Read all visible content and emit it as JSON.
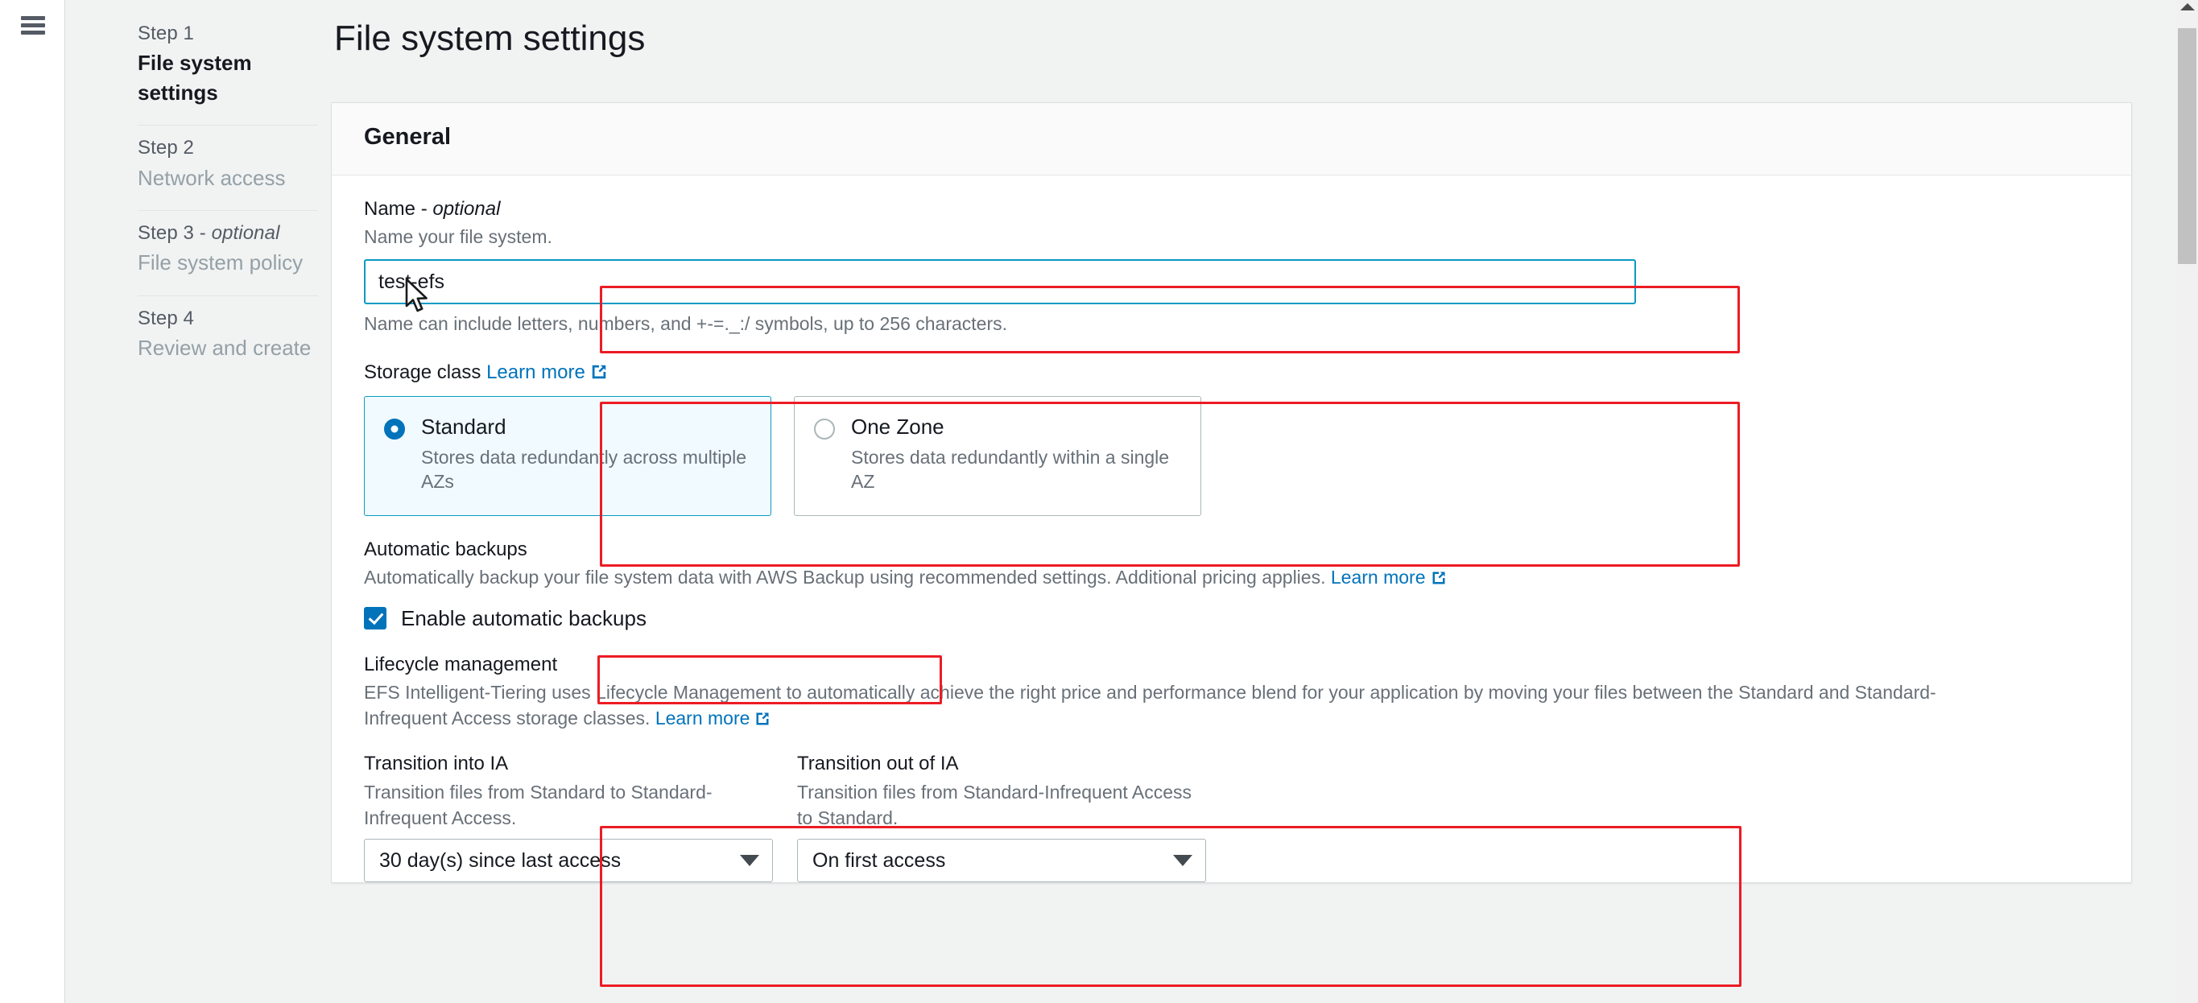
{
  "window": {
    "menu_icon": "hamburger-menu-icon"
  },
  "sidebar": {
    "steps": [
      {
        "number": "Step 1",
        "optional_suffix": "",
        "label": "File system settings",
        "active": true
      },
      {
        "number": "Step 2",
        "optional_suffix": "",
        "label": "Network access",
        "active": false
      },
      {
        "number": "Step 3 - ",
        "optional_suffix": "optional",
        "label": "File system policy",
        "active": false
      },
      {
        "number": "Step 4",
        "optional_suffix": "",
        "label": "Review and create",
        "active": false
      }
    ]
  },
  "page": {
    "title": "File system settings"
  },
  "card": {
    "header": "General"
  },
  "name_field": {
    "label": "Name - ",
    "label_optional": "optional",
    "description": "Name your file system.",
    "value": "test-efs",
    "placeholder": "",
    "hint": "Name can include letters, numbers, and +-=._:/ symbols, up to 256 characters."
  },
  "storage_class": {
    "label": "Storage class",
    "learn_more": "Learn more",
    "options": [
      {
        "title": "Standard",
        "description": "Stores data redundantly across multiple AZs",
        "selected": true
      },
      {
        "title": "One Zone",
        "description": "Stores data redundantly within a single AZ",
        "selected": false
      }
    ]
  },
  "automatic_backups": {
    "label": "Automatic backups",
    "description": "Automatically backup your file system data with AWS Backup using recommended settings. Additional pricing applies. ",
    "learn_more": "Learn more",
    "checkbox_label": "Enable automatic backups",
    "checked": true
  },
  "lifecycle_management": {
    "label": "Lifecycle management",
    "description": "EFS Intelligent-Tiering uses Lifecycle Management to automatically achieve the right price and performance blend for your application by moving your files between the Standard and Standard-Infrequent Access storage classes. ",
    "learn_more": "Learn more",
    "transition_into_ia": {
      "label": "Transition into IA",
      "description": "Transition files from Standard to Standard-Infrequent Access.",
      "value": "30 day(s) since last access"
    },
    "transition_out_of_ia": {
      "label": "Transition out of IA",
      "description": "Transition files from Standard-Infrequent Access to Standard.",
      "value": "On first access"
    }
  },
  "colors": {
    "annotation": "#ec1c24",
    "accent": "#0073bb",
    "focus": "#0a9ac4"
  }
}
